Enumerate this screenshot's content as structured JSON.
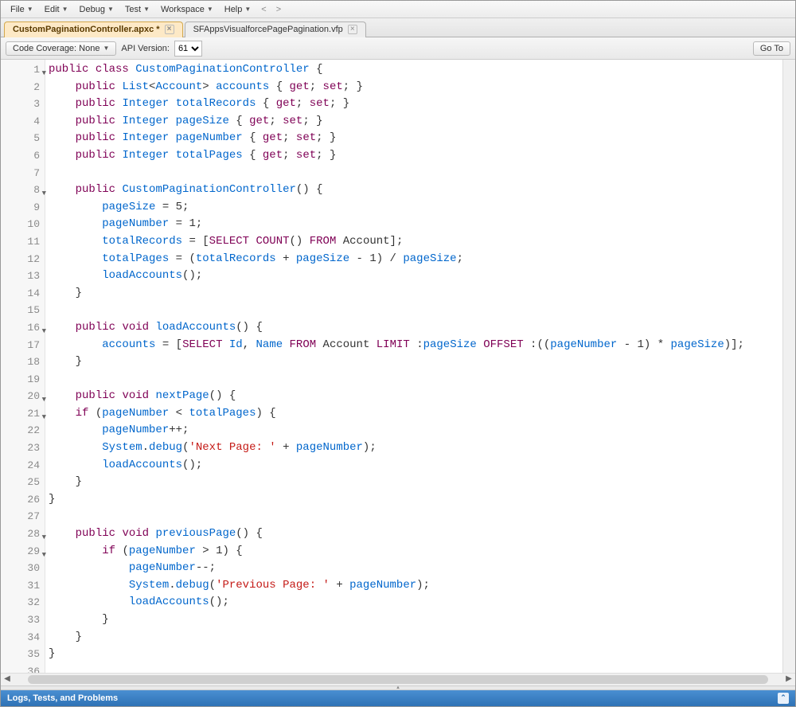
{
  "menu": {
    "items": [
      "File",
      "Edit",
      "Debug",
      "Test",
      "Workspace",
      "Help"
    ],
    "nav_prev": "<",
    "nav_next": ">"
  },
  "tabs": [
    {
      "label": "CustomPaginationController.apxc *",
      "active": true
    },
    {
      "label": "SFAppsVisualforcePagePagination.vfp",
      "active": false
    }
  ],
  "toolbar": {
    "coverage_label": "Code Coverage: None",
    "api_label": "API Version:",
    "api_value": "61",
    "goto_label": "Go To"
  },
  "code": {
    "lines": [
      {
        "n": 1,
        "fold": true,
        "tokens": [
          [
            "kw",
            "public"
          ],
          [
            "",
            ""
          ],
          [
            "kw",
            "class"
          ],
          [
            "",
            ""
          ],
          [
            "ident",
            "CustomPaginationController"
          ],
          [
            "",
            ""
          ],
          [
            "punc",
            "{"
          ]
        ]
      },
      {
        "n": 2,
        "tokens": [
          [
            "",
            "    "
          ],
          [
            "kw",
            "public"
          ],
          [
            "",
            ""
          ],
          [
            "type",
            "List"
          ],
          [
            "punc",
            "<"
          ],
          [
            "type",
            "Account"
          ],
          [
            "punc",
            "> "
          ],
          [
            "ident",
            "accounts"
          ],
          [
            "",
            ""
          ],
          [
            "punc",
            "{ "
          ],
          [
            "kw",
            "get"
          ],
          [
            "punc",
            "; "
          ],
          [
            "kw",
            "set"
          ],
          [
            "punc",
            "; }"
          ]
        ]
      },
      {
        "n": 3,
        "tokens": [
          [
            "",
            "    "
          ],
          [
            "kw",
            "public"
          ],
          [
            "",
            ""
          ],
          [
            "type",
            "Integer"
          ],
          [
            "",
            ""
          ],
          [
            "ident",
            "totalRecords"
          ],
          [
            "",
            ""
          ],
          [
            "punc",
            "{ "
          ],
          [
            "kw",
            "get"
          ],
          [
            "punc",
            "; "
          ],
          [
            "kw",
            "set"
          ],
          [
            "punc",
            "; }"
          ]
        ]
      },
      {
        "n": 4,
        "tokens": [
          [
            "",
            "    "
          ],
          [
            "kw",
            "public"
          ],
          [
            "",
            ""
          ],
          [
            "type",
            "Integer"
          ],
          [
            "",
            ""
          ],
          [
            "ident",
            "pageSize"
          ],
          [
            "",
            ""
          ],
          [
            "punc",
            "{ "
          ],
          [
            "kw",
            "get"
          ],
          [
            "punc",
            "; "
          ],
          [
            "kw",
            "set"
          ],
          [
            "punc",
            "; }"
          ]
        ]
      },
      {
        "n": 5,
        "tokens": [
          [
            "",
            "    "
          ],
          [
            "kw",
            "public"
          ],
          [
            "",
            ""
          ],
          [
            "type",
            "Integer"
          ],
          [
            "",
            ""
          ],
          [
            "ident",
            "pageNumber"
          ],
          [
            "",
            ""
          ],
          [
            "punc",
            "{ "
          ],
          [
            "kw",
            "get"
          ],
          [
            "punc",
            "; "
          ],
          [
            "kw",
            "set"
          ],
          [
            "punc",
            "; }"
          ]
        ]
      },
      {
        "n": 6,
        "tokens": [
          [
            "",
            "    "
          ],
          [
            "kw",
            "public"
          ],
          [
            "",
            ""
          ],
          [
            "type",
            "Integer"
          ],
          [
            "",
            ""
          ],
          [
            "ident",
            "totalPages"
          ],
          [
            "",
            ""
          ],
          [
            "punc",
            "{ "
          ],
          [
            "kw",
            "get"
          ],
          [
            "punc",
            "; "
          ],
          [
            "kw",
            "set"
          ],
          [
            "punc",
            "; }"
          ]
        ]
      },
      {
        "n": 7,
        "tokens": [
          [
            "",
            ""
          ]
        ]
      },
      {
        "n": 8,
        "fold": true,
        "tokens": [
          [
            "",
            "    "
          ],
          [
            "kw",
            "public"
          ],
          [
            "",
            ""
          ],
          [
            "ident",
            "CustomPaginationController"
          ],
          [
            "punc",
            "() {"
          ]
        ]
      },
      {
        "n": 9,
        "tokens": [
          [
            "",
            "        "
          ],
          [
            "ident",
            "pageSize"
          ],
          [
            "",
            ""
          ],
          [
            "punc",
            "= "
          ],
          [
            "",
            "5;"
          ]
        ]
      },
      {
        "n": 10,
        "tokens": [
          [
            "",
            "        "
          ],
          [
            "ident",
            "pageNumber"
          ],
          [
            "",
            ""
          ],
          [
            "punc",
            "= "
          ],
          [
            "",
            "1;"
          ]
        ]
      },
      {
        "n": 11,
        "tokens": [
          [
            "",
            "        "
          ],
          [
            "ident",
            "totalRecords"
          ],
          [
            "",
            ""
          ],
          [
            "punc",
            "= ["
          ],
          [
            "soql",
            "SELECT"
          ],
          [
            "",
            ""
          ],
          [
            "soql",
            "COUNT"
          ],
          [
            "punc",
            "() "
          ],
          [
            "soql",
            "FROM"
          ],
          [
            "",
            ""
          ],
          [
            "",
            "Account];"
          ]
        ]
      },
      {
        "n": 12,
        "tokens": [
          [
            "",
            "        "
          ],
          [
            "ident",
            "totalPages"
          ],
          [
            "",
            ""
          ],
          [
            "punc",
            "= ("
          ],
          [
            "ident",
            "totalRecords"
          ],
          [
            "",
            ""
          ],
          [
            "punc",
            "+ "
          ],
          [
            "ident",
            "pageSize"
          ],
          [
            "",
            ""
          ],
          [
            "punc",
            "- "
          ],
          [
            "",
            "1) / "
          ],
          [
            "ident",
            "pageSize"
          ],
          [
            "punc",
            ";"
          ]
        ]
      },
      {
        "n": 13,
        "tokens": [
          [
            "",
            "        "
          ],
          [
            "ident",
            "loadAccounts"
          ],
          [
            "punc",
            "();"
          ]
        ]
      },
      {
        "n": 14,
        "tokens": [
          [
            "",
            "    "
          ],
          [
            "punc",
            "}"
          ]
        ]
      },
      {
        "n": 15,
        "tokens": [
          [
            "",
            ""
          ]
        ]
      },
      {
        "n": 16,
        "fold": true,
        "tokens": [
          [
            "",
            "    "
          ],
          [
            "kw",
            "public"
          ],
          [
            "",
            ""
          ],
          [
            "kw",
            "void"
          ],
          [
            "",
            ""
          ],
          [
            "ident",
            "loadAccounts"
          ],
          [
            "punc",
            "() {"
          ]
        ]
      },
      {
        "n": 17,
        "tokens": [
          [
            "",
            "        "
          ],
          [
            "ident",
            "accounts"
          ],
          [
            "",
            ""
          ],
          [
            "punc",
            "= ["
          ],
          [
            "soql",
            "SELECT"
          ],
          [
            "",
            ""
          ],
          [
            "ident",
            "Id"
          ],
          [
            "punc",
            ", "
          ],
          [
            "ident",
            "Name"
          ],
          [
            "",
            ""
          ],
          [
            "soql",
            "FROM"
          ],
          [
            "",
            ""
          ],
          [
            "",
            "Account "
          ],
          [
            "soql",
            "LIMIT"
          ],
          [
            "",
            ""
          ],
          [
            "punc",
            ":"
          ],
          [
            "ident",
            "pageSize"
          ],
          [
            "",
            ""
          ],
          [
            "soql",
            "OFFSET"
          ],
          [
            "",
            ""
          ],
          [
            "punc",
            ":(("
          ],
          [
            "ident",
            "pageNumber"
          ],
          [
            "",
            ""
          ],
          [
            "punc",
            "- "
          ],
          [
            "",
            "1) * "
          ],
          [
            "ident",
            "pageSize"
          ],
          [
            "punc",
            ")];"
          ]
        ]
      },
      {
        "n": 18,
        "tokens": [
          [
            "",
            "    "
          ],
          [
            "punc",
            "}"
          ]
        ]
      },
      {
        "n": 19,
        "tokens": [
          [
            "",
            ""
          ]
        ]
      },
      {
        "n": 20,
        "fold": true,
        "tokens": [
          [
            "",
            "    "
          ],
          [
            "kw",
            "public"
          ],
          [
            "",
            ""
          ],
          [
            "kw",
            "void"
          ],
          [
            "",
            ""
          ],
          [
            "ident",
            "nextPage"
          ],
          [
            "punc",
            "() {"
          ]
        ]
      },
      {
        "n": 21,
        "fold": true,
        "tokens": [
          [
            "",
            "    "
          ],
          [
            "kw",
            "if"
          ],
          [
            "",
            ""
          ],
          [
            "punc",
            "("
          ],
          [
            "ident",
            "pageNumber"
          ],
          [
            "",
            ""
          ],
          [
            "punc",
            "< "
          ],
          [
            "ident",
            "totalPages"
          ],
          [
            "punc",
            ") {"
          ]
        ]
      },
      {
        "n": 22,
        "tokens": [
          [
            "",
            "        "
          ],
          [
            "ident",
            "pageNumber"
          ],
          [
            "punc",
            "++;"
          ]
        ]
      },
      {
        "n": 23,
        "tokens": [
          [
            "",
            "        "
          ],
          [
            "type",
            "System"
          ],
          [
            "punc",
            "."
          ],
          [
            "ident",
            "debug"
          ],
          [
            "punc",
            "("
          ],
          [
            "str",
            "'Next Page: '"
          ],
          [
            "",
            ""
          ],
          [
            "punc",
            "+ "
          ],
          [
            "ident",
            "pageNumber"
          ],
          [
            "punc",
            ");"
          ]
        ]
      },
      {
        "n": 24,
        "tokens": [
          [
            "",
            "        "
          ],
          [
            "ident",
            "loadAccounts"
          ],
          [
            "punc",
            "();"
          ]
        ]
      },
      {
        "n": 25,
        "tokens": [
          [
            "",
            "    "
          ],
          [
            "punc",
            "}"
          ]
        ]
      },
      {
        "n": 26,
        "tokens": [
          [
            "punc",
            "}"
          ]
        ]
      },
      {
        "n": 27,
        "tokens": [
          [
            "",
            ""
          ]
        ]
      },
      {
        "n": 28,
        "fold": true,
        "tokens": [
          [
            "",
            "    "
          ],
          [
            "kw",
            "public"
          ],
          [
            "",
            ""
          ],
          [
            "kw",
            "void"
          ],
          [
            "",
            ""
          ],
          [
            "ident",
            "previousPage"
          ],
          [
            "punc",
            "() {"
          ]
        ]
      },
      {
        "n": 29,
        "fold": true,
        "tokens": [
          [
            "",
            "        "
          ],
          [
            "kw",
            "if"
          ],
          [
            "",
            ""
          ],
          [
            "punc",
            "("
          ],
          [
            "ident",
            "pageNumber"
          ],
          [
            "",
            ""
          ],
          [
            "punc",
            "> "
          ],
          [
            "",
            "1) {"
          ]
        ]
      },
      {
        "n": 30,
        "tokens": [
          [
            "",
            "            "
          ],
          [
            "ident",
            "pageNumber"
          ],
          [
            "punc",
            "--;"
          ]
        ]
      },
      {
        "n": 31,
        "tokens": [
          [
            "",
            "            "
          ],
          [
            "type",
            "System"
          ],
          [
            "punc",
            "."
          ],
          [
            "ident",
            "debug"
          ],
          [
            "punc",
            "("
          ],
          [
            "str",
            "'Previous Page: '"
          ],
          [
            "",
            ""
          ],
          [
            "punc",
            "+ "
          ],
          [
            "ident",
            "pageNumber"
          ],
          [
            "punc",
            ");"
          ]
        ]
      },
      {
        "n": 32,
        "tokens": [
          [
            "",
            "            "
          ],
          [
            "ident",
            "loadAccounts"
          ],
          [
            "punc",
            "();"
          ]
        ]
      },
      {
        "n": 33,
        "tokens": [
          [
            "",
            "        "
          ],
          [
            "punc",
            "}"
          ]
        ]
      },
      {
        "n": 34,
        "tokens": [
          [
            "",
            "    "
          ],
          [
            "punc",
            "}"
          ]
        ]
      },
      {
        "n": 35,
        "tokens": [
          [
            "punc",
            "}"
          ]
        ]
      },
      {
        "n": 36,
        "tokens": [
          [
            "",
            ""
          ]
        ]
      }
    ]
  },
  "bottom": {
    "label": "Logs, Tests, and Problems"
  }
}
